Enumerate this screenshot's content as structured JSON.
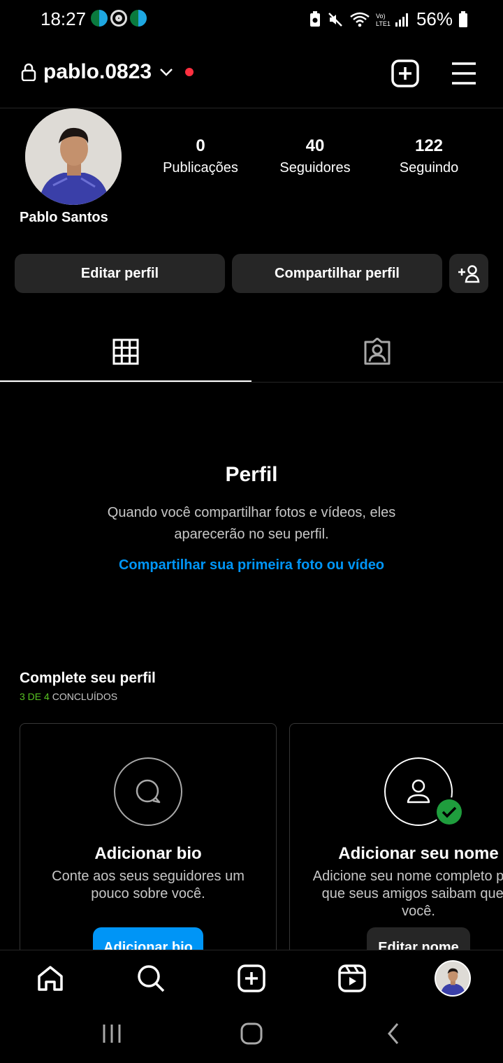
{
  "status_bar": {
    "time": "18:27",
    "battery": "56%"
  },
  "header": {
    "username": "pablo.0823",
    "icons": [
      "lock-icon",
      "chevron-down-icon",
      "add-post-icon",
      "menu-icon"
    ]
  },
  "profile": {
    "display_name": "Pablo Santos",
    "stats": [
      {
        "value": "0",
        "label": "Publicações"
      },
      {
        "value": "40",
        "label": "Seguidores"
      },
      {
        "value": "122",
        "label": "Seguindo"
      }
    ],
    "buttons": {
      "edit": "Editar perfil",
      "share": "Compartilhar perfil"
    }
  },
  "tabs": [
    "grid-icon",
    "tagged-icon"
  ],
  "empty_state": {
    "title": "Perfil",
    "description": "Quando você compartilhar fotos e vídeos, eles aparecerão no seu perfil.",
    "link": "Compartilhar sua primeira foto ou vídeo"
  },
  "complete_profile": {
    "title": "Complete seu perfil",
    "progress_done": "3 DE 4",
    "progress_suffix": "CONCLUÍDOS",
    "cards": [
      {
        "title": "Adicionar bio",
        "description": "Conte aos seus seguidores um pouco sobre você.",
        "button": "Adicionar bio"
      },
      {
        "title": "Adicionar seu nome",
        "description": "Adicione seu nome completo para que seus amigos saibam que é você.",
        "button": "Editar nome"
      }
    ]
  },
  "colors": {
    "accent": "#0095f6",
    "success": "#58c322",
    "notification": "#ff3040",
    "surface": "#262626"
  }
}
